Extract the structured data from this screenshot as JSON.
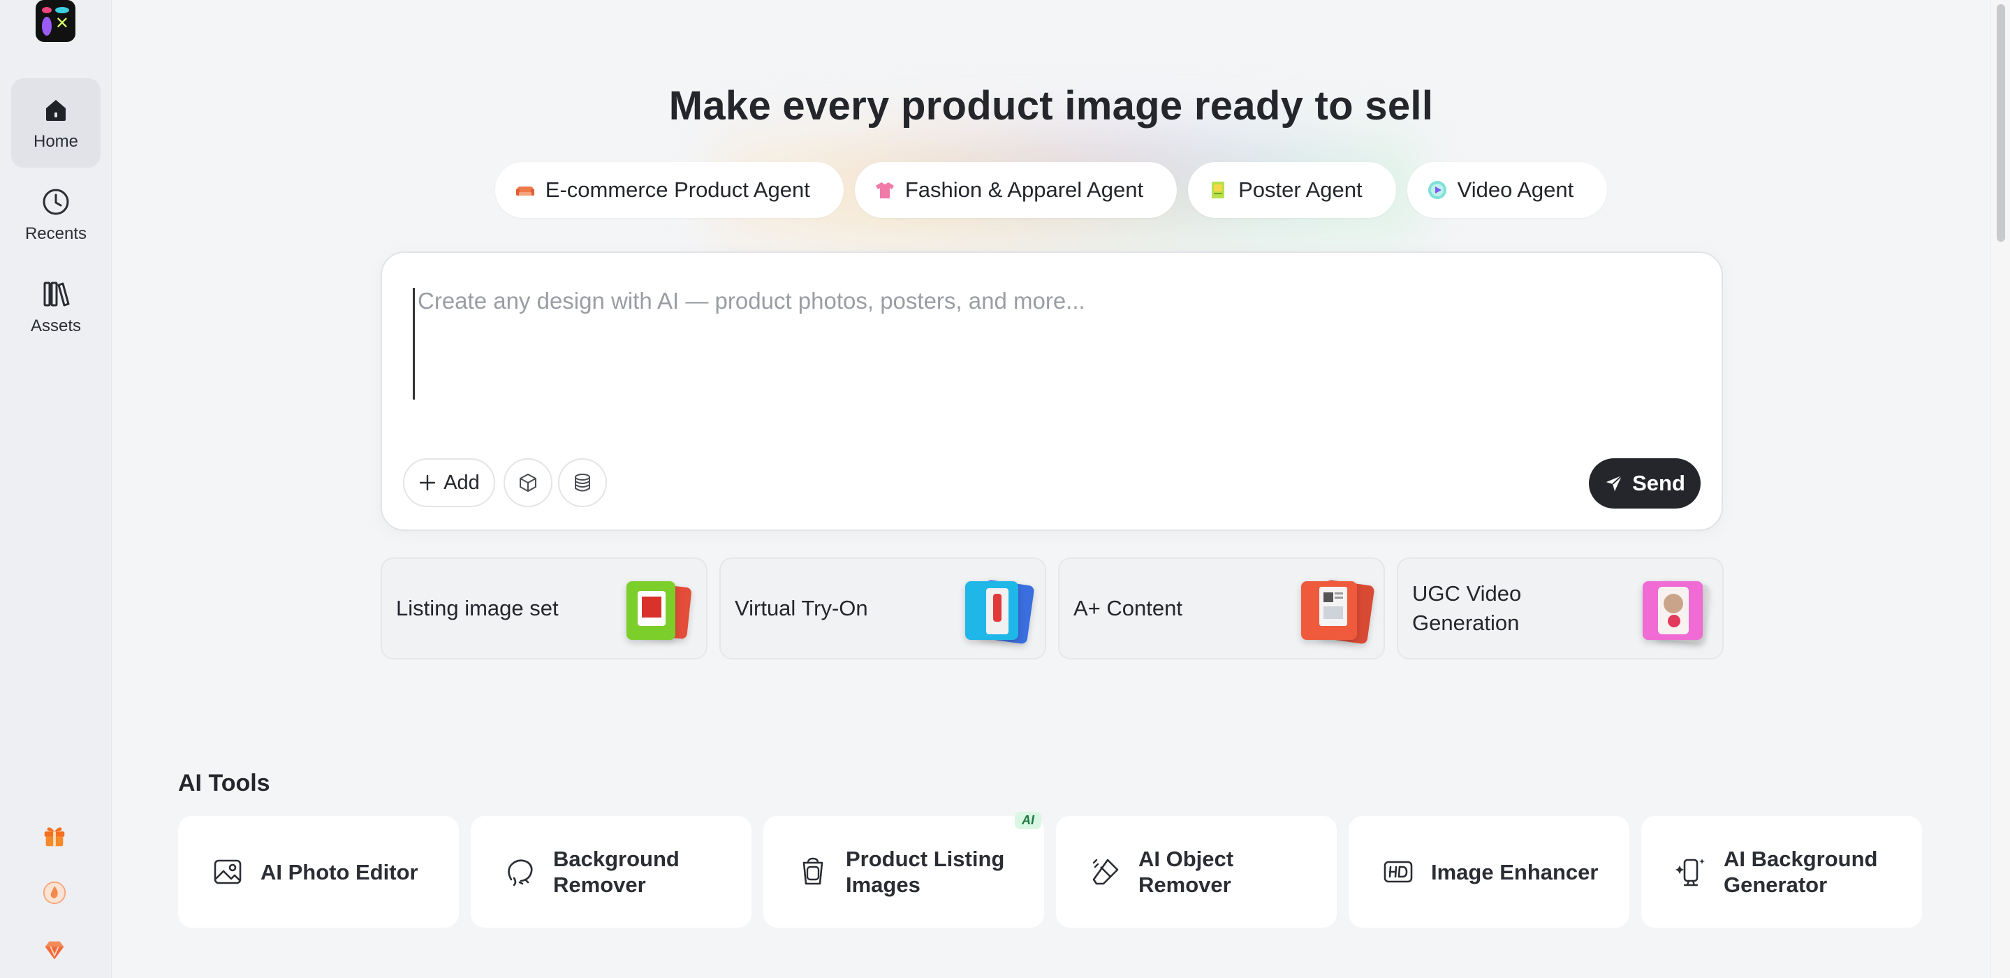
{
  "sidebar": {
    "items": [
      {
        "label": "Home",
        "icon": "home-icon",
        "active": true
      },
      {
        "label": "Recents",
        "icon": "clock-icon"
      },
      {
        "label": "Assets",
        "icon": "library-icon"
      }
    ],
    "bottom_icons": [
      "gift-icon",
      "fire-icon",
      "diamond-icon"
    ]
  },
  "hero": {
    "title": "Make every product image ready to sell"
  },
  "agents": [
    {
      "label": "E-commerce Product Agent",
      "icon": "sofa-icon"
    },
    {
      "label": "Fashion & Apparel Agent",
      "icon": "tshirt-icon"
    },
    {
      "label": "Poster Agent",
      "icon": "poster-icon"
    },
    {
      "label": "Video Agent",
      "icon": "play-icon"
    }
  ],
  "prompt": {
    "placeholder": "Create any design with AI — product photos, posters, and more...",
    "value": "",
    "add_label": "Add",
    "send_label": "Send"
  },
  "quick_actions": [
    {
      "label": "Listing image set",
      "thumb_colors": [
        "#7ccf2a",
        "#e44d3a"
      ]
    },
    {
      "label": "Virtual Try-On",
      "thumb_colors": [
        "#1fb6e8",
        "#3b6fe0"
      ]
    },
    {
      "label": "A+ Content",
      "thumb_colors": [
        "#ef5a3c",
        "#d94a35"
      ]
    },
    {
      "label": "UGC Video Generation",
      "thumb_colors": [
        "#f06bd3",
        "#c94fe0"
      ]
    }
  ],
  "ai_tools": {
    "title": "AI Tools",
    "items": [
      {
        "label": "AI Photo Editor",
        "icon": "photo-icon"
      },
      {
        "label": "Background Remover",
        "icon": "lasso-icon"
      },
      {
        "label": "Product Listing Images",
        "icon": "bag-icon",
        "badge": "AI"
      },
      {
        "label": "AI Object Remover",
        "icon": "eraser-icon"
      },
      {
        "label": "Image Enhancer",
        "icon": "hd-icon"
      },
      {
        "label": "AI Background Generator",
        "icon": "phone-sparkle-icon"
      }
    ]
  }
}
